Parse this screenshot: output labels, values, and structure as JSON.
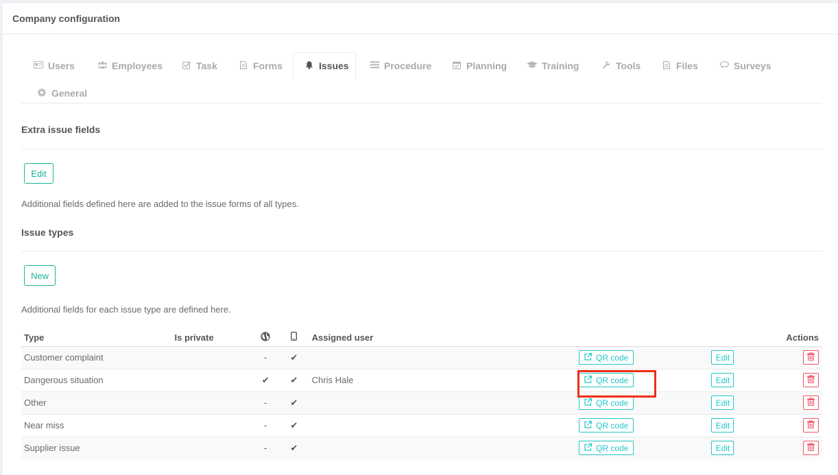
{
  "header": {
    "title": "Company configuration"
  },
  "tabs": [
    {
      "label": "Users",
      "icon": "id-card-icon"
    },
    {
      "label": "Employees",
      "icon": "users-icon"
    },
    {
      "label": "Task",
      "icon": "check-square-icon"
    },
    {
      "label": "Forms",
      "icon": "file-icon"
    },
    {
      "label": "Issues",
      "icon": "bell-icon",
      "active": true
    },
    {
      "label": "Procedure",
      "icon": "list-icon"
    },
    {
      "label": "Planning",
      "icon": "calendar-check-icon"
    },
    {
      "label": "Training",
      "icon": "graduation-cap-icon"
    },
    {
      "label": "Tools",
      "icon": "wrench-icon"
    },
    {
      "label": "Files",
      "icon": "file-icon"
    },
    {
      "label": "Surveys",
      "icon": "comment-icon"
    },
    {
      "label": "General",
      "icon": "gear-icon"
    }
  ],
  "extra_fields": {
    "title": "Extra issue fields",
    "edit_label": "Edit",
    "help": "Additional fields defined here are added to the issue forms of all types."
  },
  "issue_types": {
    "title": "Issue types",
    "new_label": "New",
    "help": "Additional fields for each issue type are defined here.",
    "columns": {
      "type": "Type",
      "is_private": "Is private",
      "public_icon": "globe-icon",
      "mobile_icon": "mobile-icon",
      "assigned_user": "Assigned user",
      "actions": "Actions"
    },
    "qr_label": "QR code",
    "edit_label": "Edit",
    "rows": [
      {
        "type": "Customer complaint",
        "public": "-",
        "mobile": "✔",
        "assigned": ""
      },
      {
        "type": "Dangerous situation",
        "public": "✔",
        "mobile": "✔",
        "assigned": "Chris Hale"
      },
      {
        "type": "Other",
        "public": "-",
        "mobile": "✔",
        "assigned": ""
      },
      {
        "type": "Near miss",
        "public": "-",
        "mobile": "✔",
        "assigned": ""
      },
      {
        "type": "Supplier issue",
        "public": "-",
        "mobile": "✔",
        "assigned": ""
      }
    ]
  },
  "colors": {
    "accent": "#1ab394",
    "info": "#23c6c8",
    "danger": "#ed5565",
    "highlight": "#ee2d12"
  }
}
